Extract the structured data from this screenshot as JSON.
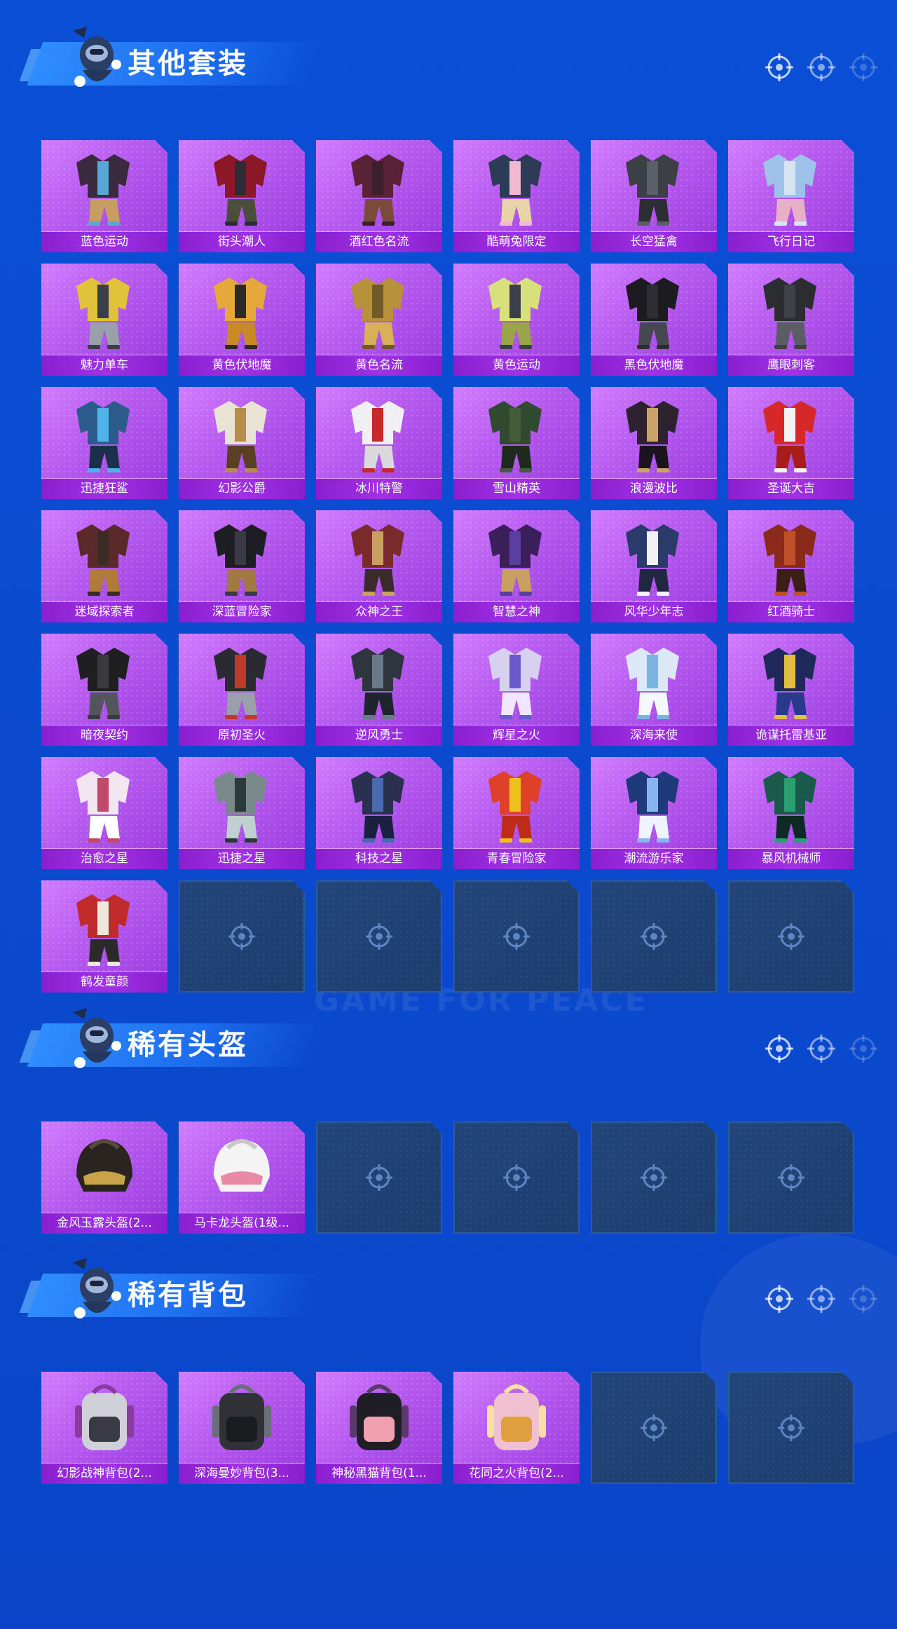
{
  "watermark": "GAME FOR PEACE",
  "sections": [
    {
      "title": "其他套装",
      "items": [
        "蓝色运动",
        "街头潮人",
        "酒红色名流",
        "酷萌兔限定",
        "长空猛禽",
        "飞行日记",
        "魅力单车",
        "黄色伏地魔",
        "黄色名流",
        "黄色运动",
        "黑色伏地魔",
        "鹰眼刺客",
        "迅捷狂鲨",
        "幻影公爵",
        "冰川特警",
        "雪山精英",
        "浪漫波比",
        "圣诞大吉",
        "迷域探索者",
        "深蓝冒险家",
        "众神之王",
        "智慧之神",
        "风华少年志",
        "红酒骑士",
        "暗夜契约",
        "原初圣火",
        "逆风勇士",
        "辉星之火",
        "深海来使",
        "诡谋托雷基亚",
        "治愈之星",
        "迅捷之星",
        "科技之星",
        "青春冒险家",
        "潮流游乐家",
        "暴风机械师",
        "鹤发童颜"
      ],
      "empty_slots": 5
    },
    {
      "title": "稀有头盔",
      "items": [
        "金风玉露头盔(2...",
        "马卡龙头盔(1级..."
      ],
      "empty_slots": 4
    },
    {
      "title": "稀有背包",
      "items": [
        "幻影战神背包(2...",
        "深海曼妙背包(3...",
        "神秘黑猫背包(1...",
        "花同之火背包(2..."
      ],
      "empty_slots": 2
    }
  ],
  "colors": {
    "background": "#0a4fd6",
    "card": "#b44fe8",
    "label_bar": "#8a1fd0",
    "empty_slot": "#22457a"
  },
  "icons": {
    "mascot": "parachute-soldier-icon",
    "header_marker": "crosshair-target-icon",
    "empty_slot": "crosshair-target-icon"
  }
}
